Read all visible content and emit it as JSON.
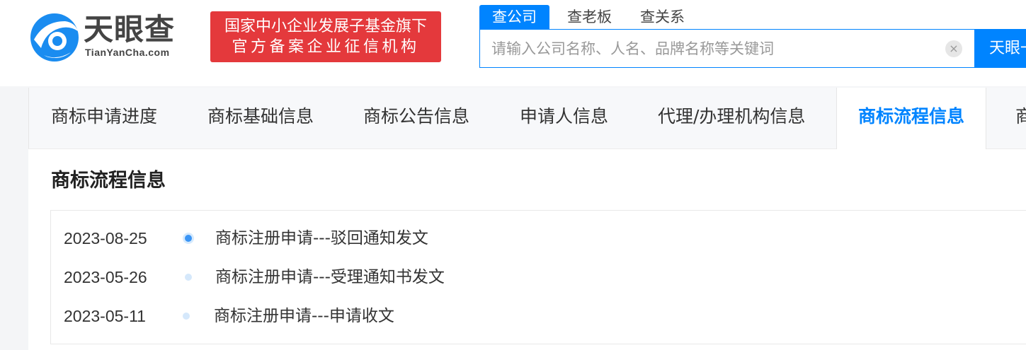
{
  "brand": {
    "name_cn": "天眼查",
    "name_en": "TianYanCha.com",
    "badge_line1": "国家中小企业发展子基金旗下",
    "badge_line2": "官方备案企业征信机构",
    "colors": {
      "primary": "#0084ff",
      "badge": "#e4393c"
    }
  },
  "search": {
    "tabs": [
      {
        "label": "查公司",
        "active": true
      },
      {
        "label": "查老板",
        "active": false
      },
      {
        "label": "查关系",
        "active": false
      }
    ],
    "placeholder": "请输入公司名称、人名、品牌名称等关键词",
    "clear_icon": "×",
    "button_label": "天眼一下"
  },
  "tabs": [
    {
      "label": "商标申请进度",
      "active": false
    },
    {
      "label": "商标基础信息",
      "active": false
    },
    {
      "label": "商标公告信息",
      "active": false
    },
    {
      "label": "申请人信息",
      "active": false
    },
    {
      "label": "代理/办理机构信息",
      "active": false
    },
    {
      "label": "商标流程信息",
      "active": true
    },
    {
      "label": "商标",
      "active": false
    }
  ],
  "section": {
    "title": "商标流程信息",
    "timeline": [
      {
        "date": "2023-08-25",
        "text": "商标注册申请---驳回通知发文"
      },
      {
        "date": "2023-05-26",
        "text": "商标注册申请---受理通知书发文"
      },
      {
        "date": "2023-05-11",
        "text": "商标注册申请---申请收文"
      }
    ]
  }
}
